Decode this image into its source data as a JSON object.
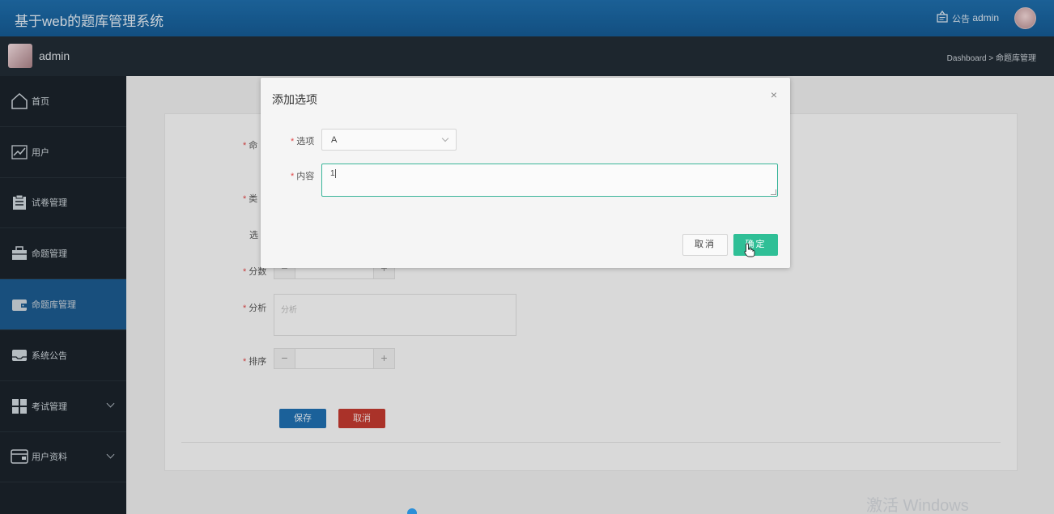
{
  "header": {
    "app_title": "基于web的题库管理系统",
    "notice_label": "公告",
    "user_name": "admin"
  },
  "subbar": {
    "user_name": "admin",
    "breadcrumb": "Dashboard > 命题库管理"
  },
  "sidebar": {
    "items": [
      {
        "label": "首页",
        "icon": "home-icon"
      },
      {
        "label": "用户",
        "icon": "trend-chart-icon"
      },
      {
        "label": "试卷管理",
        "icon": "clipboard-icon"
      },
      {
        "label": "命题管理",
        "icon": "briefcase-icon"
      },
      {
        "label": "命题库管理",
        "icon": "wallet-icon",
        "active": true
      },
      {
        "label": "系统公告",
        "icon": "inbox-icon"
      },
      {
        "label": "考试管理",
        "icon": "grid-icon",
        "expandable": true
      },
      {
        "label": "用户资料",
        "icon": "card-icon",
        "expandable": true
      }
    ]
  },
  "form": {
    "label_question": "命",
    "label_type": "类",
    "label_options": "选",
    "label_score": "分数",
    "label_analysis": "分析",
    "analysis_placeholder": "分析",
    "label_sort": "排序",
    "stepper_minus": "−",
    "stepper_plus": "+",
    "save_label": "保存",
    "cancel_label": "取消"
  },
  "modal": {
    "title": "添加选项",
    "close_symbol": "×",
    "option_label": "选项",
    "option_value": "A",
    "content_label": "内容",
    "content_value": "1",
    "cancel_label": "取消",
    "ok_label": "确定"
  },
  "watermark": "激活 Windows",
  "colors": {
    "header_blue": "#1b66a3",
    "sidebar_bg": "#1b232b",
    "active_item": "#1c5a8f",
    "confirm_green": "#2fbf96",
    "cancel_red": "#c2392f",
    "save_blue": "#1f6fb0"
  }
}
